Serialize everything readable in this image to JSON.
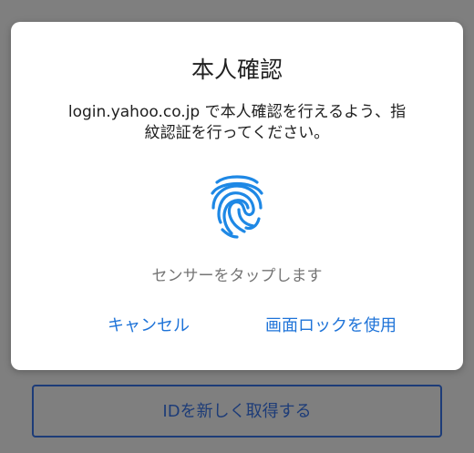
{
  "dialog": {
    "title": "本人確認",
    "message_line1": "login.yahoo.co.jp で本人確認を行えるよう、指",
    "message_line2": "紋認証を行ってください。",
    "status": "センサーをタップします",
    "cancel_label": "キャンセル",
    "screen_lock_label": "画面ロックを使用",
    "fingerprint_icon": "fingerprint-icon"
  },
  "background": {
    "acquire_id_label": "IDを新しく取得する"
  },
  "colors": {
    "accent": "#1e73d8",
    "scrim": "#7f7f7f",
    "underlying_button": "#1d3c78"
  }
}
